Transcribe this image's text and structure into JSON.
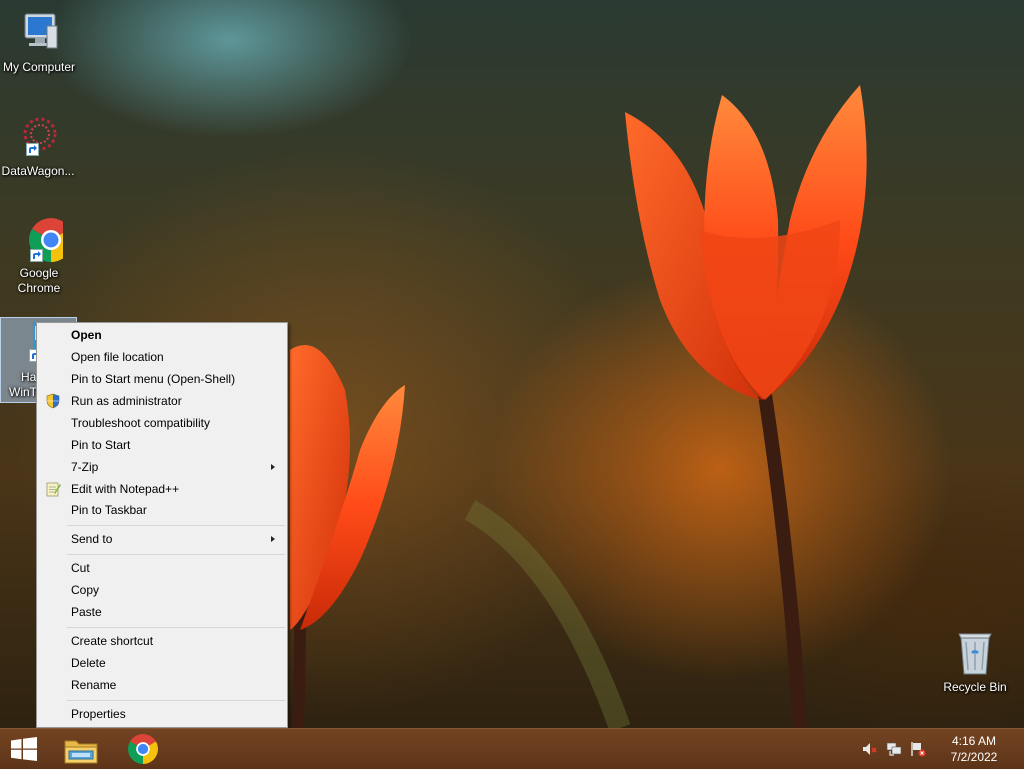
{
  "desktop": {
    "icons": [
      {
        "label": "My Computer"
      },
      {
        "label": "DataWagon..."
      },
      {
        "label_line1": "Google",
        "label_line2": "Chrome"
      },
      {
        "label_line1": "Ha",
        "label_line2": "WinT"
      },
      {
        "label": "Recycle Bin"
      }
    ]
  },
  "context_menu": {
    "items": [
      {
        "label": "Open"
      },
      {
        "label": "Open file location"
      },
      {
        "label": "Pin to Start menu (Open-Shell)"
      },
      {
        "label": "Run as administrator",
        "icon": "shield-icon"
      },
      {
        "label": "Troubleshoot compatibility"
      },
      {
        "label": "Pin to Start"
      },
      {
        "label": "7-Zip"
      },
      {
        "label": "Edit with Notepad++",
        "icon": "notepadpp-icon"
      },
      {
        "label": "Pin to Taskbar"
      },
      {
        "label": "Send to"
      },
      {
        "label": "Cut"
      },
      {
        "label": "Copy"
      },
      {
        "label": "Paste"
      },
      {
        "label": "Create shortcut"
      },
      {
        "label": "Delete"
      },
      {
        "label": "Rename"
      },
      {
        "label": "Properties"
      }
    ]
  },
  "taskbar": {
    "pinned": [
      {
        "icon": "windows-start-icon"
      },
      {
        "icon": "file-explorer-icon"
      },
      {
        "icon": "chrome-icon"
      }
    ],
    "tray": [
      {
        "icon": "volume-muted-icon"
      },
      {
        "icon": "network-disconnected-icon"
      },
      {
        "icon": "action-center-flag-icon"
      }
    ],
    "clock": {
      "time": "4:16 AM",
      "date": "7/2/2022"
    }
  },
  "colors": {
    "menu_bg": "#f0f0f0",
    "taskbar": "#6e3c19",
    "tulip": "#ff4a1a"
  }
}
